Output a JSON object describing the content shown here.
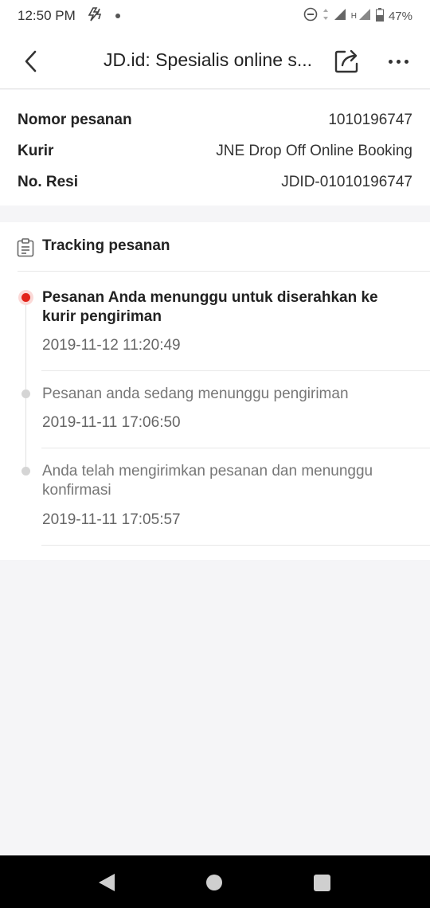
{
  "status_bar": {
    "time": "12:50 PM",
    "battery": "47%",
    "network_label": "H"
  },
  "header": {
    "title": "JD.id: Spesialis online s..."
  },
  "order": {
    "rows": [
      {
        "label": "Nomor pesanan",
        "value": "1010196747"
      },
      {
        "label": "Kurir",
        "value": "JNE Drop Off Online Booking"
      },
      {
        "label": "No. Resi",
        "value": "JDID-01010196747"
      }
    ]
  },
  "tracking": {
    "title": "Tracking pesanan",
    "events": [
      {
        "text": "Pesanan Anda menunggu untuk diserahkan ke kurir pengiriman",
        "time": "2019-11-12 11:20:49",
        "active": true
      },
      {
        "text": "Pesanan anda sedang menunggu pengiriman",
        "time": "2019-11-11 17:06:50",
        "active": false
      },
      {
        "text": "Anda telah mengirimkan pesanan dan menunggu konfirmasi",
        "time": "2019-11-11 17:05:57",
        "active": false
      }
    ]
  },
  "colors": {
    "accent": "#e2231a",
    "page_bg": "#f5f5f7"
  },
  "icons": {
    "back": "chevron-left-icon",
    "share": "share-icon",
    "more": "more-icon",
    "tracking": "clipboard-icon"
  }
}
